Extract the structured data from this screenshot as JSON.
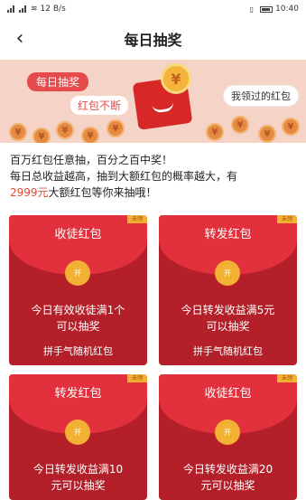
{
  "status_bar": {
    "left": "12 B/s",
    "right": "10:40"
  },
  "header": {
    "title": "每日抽奖"
  },
  "banner": {
    "tag_daily": "每日抽奖",
    "tag_non_stop": "红包不断",
    "received_button": "我领过的红包",
    "coin_symbol": "¥"
  },
  "description": {
    "line1": "百万红包任意抽，百分之百中奖！",
    "line2": "每日总收益越高，抽到大额红包的概率越大，有",
    "amount": "2999元",
    "line3_suffix": "大额红包等你来抽哦！"
  },
  "cards": [
    {
      "label": "收徒红包",
      "open": "开",
      "condition_line1": "今日有效收徒满1个",
      "condition_line2": "可以抽奖",
      "sub": "拼手气随机红包",
      "flag": "未领"
    },
    {
      "label": "转发红包",
      "open": "开",
      "condition_line1": "今日转发收益满5元",
      "condition_line2": "可以抽奖",
      "sub": "拼手气随机红包",
      "flag": "未领"
    },
    {
      "label": "转发红包",
      "open": "开",
      "condition_line1": "今日转发收益满10",
      "condition_line2": "元可以抽奖",
      "sub": "",
      "flag": "未领"
    },
    {
      "label": "收徒红包",
      "open": "开",
      "condition_line1": "今日转发收益满20",
      "condition_line2": "元可以抽奖",
      "sub": "",
      "flag": "未领"
    }
  ]
}
